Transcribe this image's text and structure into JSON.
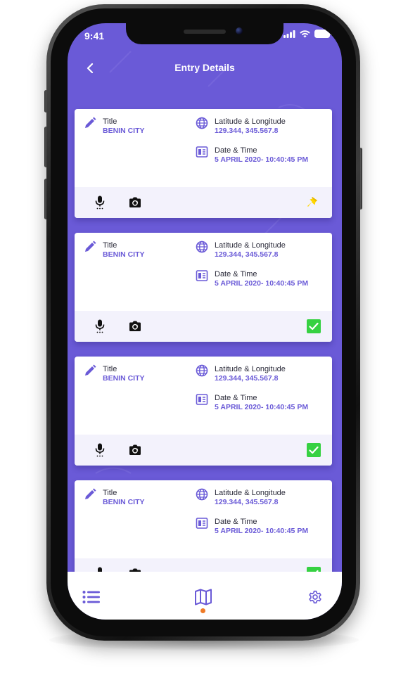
{
  "status_bar": {
    "time": "9:41"
  },
  "header": {
    "title": "Entry Details",
    "back_icon": "chevron-left-icon"
  },
  "colors": {
    "primary": "#6a5ad7",
    "card_footer": "#f3f2fc",
    "check_green": "#36d142",
    "pin_yellow": "#ffd600",
    "active_dot": "#f07b27"
  },
  "entries": [
    {
      "title_label": "Title",
      "title_value": "BENIN CITY",
      "coords_label": "Latitude & Longitude",
      "coords_value": "129.344, 345.567.8",
      "date_label": "Date & Time",
      "date_value": "5 APRIL 2020- 10:40:45 PM",
      "status": "pin"
    },
    {
      "title_label": "Title",
      "title_value": "BENIN CITY",
      "coords_label": "Latitude & Longitude",
      "coords_value": "129.344, 345.567.8",
      "date_label": "Date & Time",
      "date_value": "5 APRIL 2020- 10:40:45 PM",
      "status": "check"
    },
    {
      "title_label": "Title",
      "title_value": "BENIN CITY",
      "coords_label": "Latitude & Longitude",
      "coords_value": "129.344, 345.567.8",
      "date_label": "Date & Time",
      "date_value": "5 APRIL 2020- 10:40:45 PM",
      "status": "check"
    },
    {
      "title_label": "Title",
      "title_value": "BENIN CITY",
      "coords_label": "Latitude & Longitude",
      "coords_value": "129.344, 345.567.8",
      "date_label": "Date & Time",
      "date_value": "5 APRIL 2020- 10:40:45 PM",
      "status": "check"
    }
  ],
  "tabbar": {
    "items": [
      "list-icon",
      "map-icon",
      "gear-icon"
    ],
    "active": "map-icon"
  }
}
